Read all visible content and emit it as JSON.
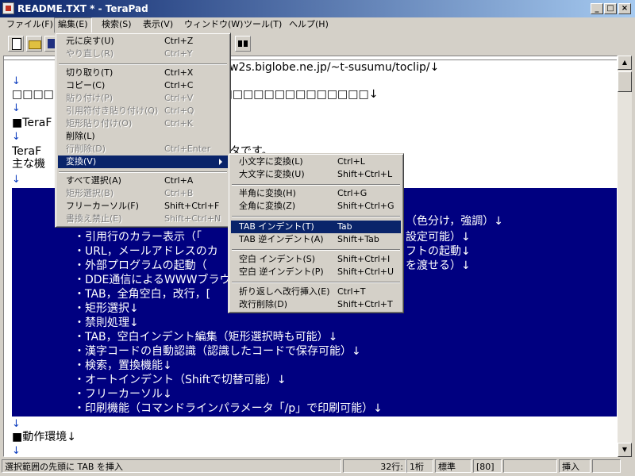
{
  "window": {
    "title": "README.TXT * - TeraPad"
  },
  "menubar": [
    "ファイル(F)",
    "編集(E)",
    "検索(S)",
    "表示(V)",
    "ウィンドウ(W)",
    "ツール(T)",
    "ヘルプ(H)"
  ],
  "editor": {
    "lines": [
      "w2s.biglobe.ne.jp/~t-susumu/toclip/↓",
      "↓",
      "□□□□□□□□□□□□□□□□□□□□□□□□□□□□□□□□□□↓",
      "↓",
      "■TeraF",
      "↓",
      "  TeraF",
      "タです。",
      "  主な機",
      "↓"
    ],
    "selected_lines": [
      "（色分け，強調）↓",
      "・引用行のカラー表示（「",
      "設定可能）↓",
      "・URL，メールアドレスのカ",
      "フトの起動↓",
      "・外部プログラムの起動（",
      "を渡せる）↓",
      "・DDE通信によるWWWブラウ",
      "・TAB，全角空白，改行，[",
      "・矩形選択↓",
      "・禁則処理↓",
      "・TAB，空白インデント編集（矩形選択時も可能）↓",
      "・漢字コードの自動認識（認識したコードで保存可能）↓",
      "・検索，置換機能↓",
      "・オートインデント（Shiftで切替可能）↓",
      "・フリーカーソル↓",
      "・印刷機能（コマンドラインパラメータ「/p」で印刷可能）↓"
    ],
    "after": [
      "↓",
      "■動作環境↓",
      "↓"
    ]
  },
  "edit_menu": {
    "items": [
      {
        "label": "元に戻す(U)",
        "shortcut": "Ctrl+Z",
        "disabled": false
      },
      {
        "label": "やり直し(R)",
        "shortcut": "Ctrl+Y",
        "disabled": true
      },
      {
        "label": "切り取り(T)",
        "shortcut": "Ctrl+X",
        "disabled": false
      },
      {
        "label": "コピー(C)",
        "shortcut": "Ctrl+C",
        "disabled": false
      },
      {
        "label": "貼り付け(P)",
        "shortcut": "Ctrl+V",
        "disabled": true
      },
      {
        "label": "引用符付き貼り付け(Q)",
        "shortcut": "Ctrl+Q",
        "disabled": true
      },
      {
        "label": "矩形貼り付け(O)",
        "shortcut": "Ctrl+K",
        "disabled": true
      },
      {
        "label": "削除(L)",
        "shortcut": "",
        "disabled": false
      },
      {
        "label": "行削除(D)",
        "shortcut": "Ctrl+Enter",
        "disabled": true
      },
      {
        "label": "変換(V)",
        "shortcut": "",
        "disabled": false
      },
      {
        "label": "すべて選択(A)",
        "shortcut": "Ctrl+A",
        "disabled": false
      },
      {
        "label": "矩形選択(B)",
        "shortcut": "Ctrl+B",
        "disabled": true
      },
      {
        "label": "フリーカーソル(F)",
        "shortcut": "Shift+Ctrl+F",
        "disabled": false
      },
      {
        "label": "書換え禁止(E)",
        "shortcut": "Shift+Ctrl+N",
        "disabled": true
      }
    ]
  },
  "convert_menu": {
    "items": [
      {
        "label": "小文字に変換(L)",
        "shortcut": "Ctrl+L"
      },
      {
        "label": "大文字に変換(U)",
        "shortcut": "Shift+Ctrl+L"
      },
      {
        "label": "半角に変換(H)",
        "shortcut": "Ctrl+G"
      },
      {
        "label": "全角に変換(Z)",
        "shortcut": "Shift+Ctrl+G"
      },
      {
        "label": "TAB インデント(T)",
        "shortcut": "Tab"
      },
      {
        "label": "TAB 逆インデント(A)",
        "shortcut": "Shift+Tab"
      },
      {
        "label": "空白 インデント(S)",
        "shortcut": "Shift+Ctrl+I"
      },
      {
        "label": "空白 逆インデント(P)",
        "shortcut": "Shift+Ctrl+U"
      },
      {
        "label": "折り返しへ改行挿入(E)",
        "shortcut": "Ctrl+T"
      },
      {
        "label": "改行削除(D)",
        "shortcut": "Shift+Ctrl+T"
      }
    ]
  },
  "status": {
    "message": "選択範囲の先頭に TAB を挿入",
    "line": "32行:",
    "col": "1桁",
    "encoding": "標準",
    "width": "[80]",
    "mode": "挿入"
  }
}
